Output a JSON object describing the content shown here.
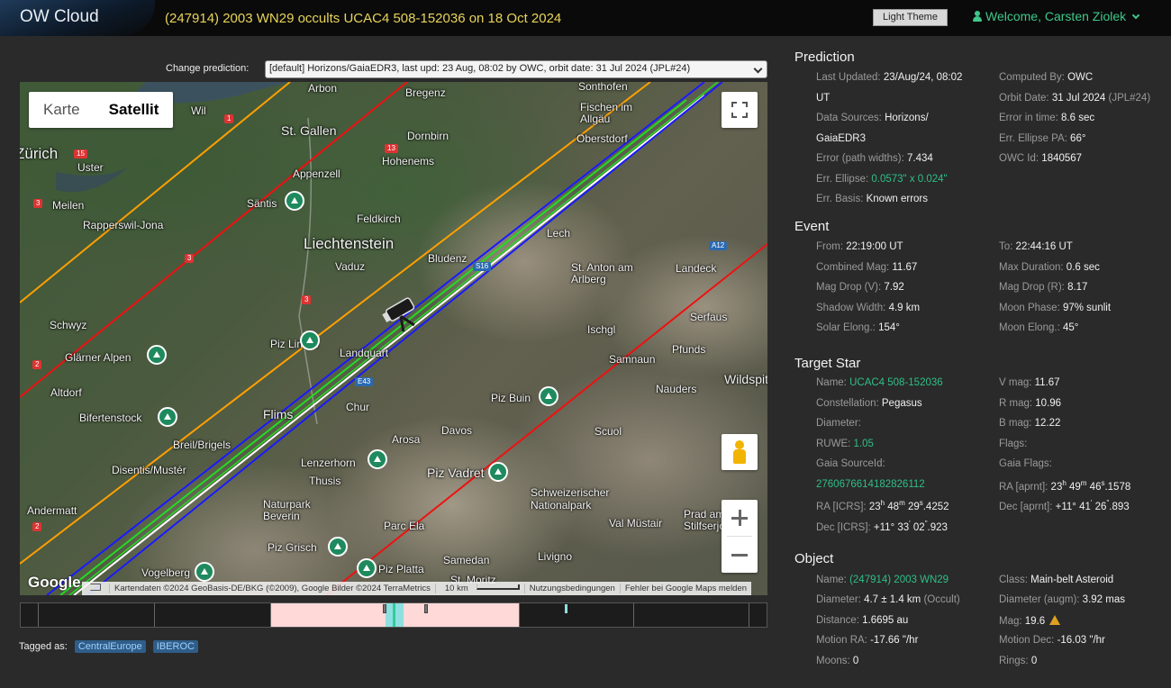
{
  "header": {
    "logo": "OW Cloud",
    "title": "(247914) 2003 WN29 occults UCAC4 508-152036 on 18 Oct 2024",
    "theme_button": "Light Theme",
    "welcome": "Welcome, Carsten Ziolek"
  },
  "prediction_select": {
    "label": "Change prediction:",
    "value": "[default] Horizons/GaiaEDR3, last upd: 23 Aug, 08:02 by OWC, orbit date: 31 Jul 2024 (JPL#24)"
  },
  "map": {
    "type_options": [
      "Karte",
      "Satellit"
    ],
    "active_type": "Satellit",
    "logo": "Google",
    "attribution": "Kartendaten ©2024 GeoBasis-DE/BKG (©2009), Google Bilder ©2024 TerraMetrics",
    "scale": "10 km",
    "terms": "Nutzungsbedingungen",
    "report": "Fehler bei Google Maps melden",
    "places": [
      "Arbon",
      "Bregenz",
      "Sonthofen",
      "Wil",
      "Fischen im Allgäu",
      "St. Gallen",
      "Dornbirn",
      "Oberstdorf",
      "Zürich",
      "Uster",
      "Appenzell",
      "Hohenems",
      "Meilen",
      "Säntis",
      "Rapperswil-Jona",
      "Feldkirch",
      "Liechtenstein",
      "Lech",
      "Vaduz",
      "Bludenz",
      "St. Anton am Arlberg",
      "Landeck",
      "Schwyz",
      "Ischgl",
      "Serfaus",
      "Glärner Alpen",
      "Piz Linard",
      "Landquart",
      "Pfunds",
      "Samnaun",
      "Altdorf",
      "Wildspitze",
      "Piz Buin",
      "Nauders",
      "Flims",
      "Chur",
      "Bifertenstock",
      "Scuol",
      "Breil/Brigels",
      "Arosa",
      "Davos",
      "Disentis/Mustér",
      "Lenzerhorn",
      "Thusis",
      "Piz Vadret",
      "Schweizerischer Nationalpark",
      "Andermatt",
      "Naturpark Beverin",
      "Parc Ela",
      "Val Müstair",
      "Prad am Stilfserjoch",
      "Piz Grisch",
      "Samedan",
      "Vogelberg",
      "Piz Platta",
      "Livigno",
      "St. Moritz"
    ],
    "road_labels": [
      "1",
      "13",
      "15",
      "3",
      "3",
      "3",
      "2",
      "2",
      "A12",
      "E43",
      "S16"
    ]
  },
  "timeline": {
    "segments": 7
  },
  "tags": {
    "label": "Tagged as:",
    "items": [
      "CentralEurope",
      "IBEROC"
    ]
  },
  "prediction": {
    "title": "Prediction",
    "last_updated_label": "Last Updated:",
    "last_updated": "23/Aug/24, 08:02",
    "last_updated_tz": "UT",
    "computed_by_label": "Computed By:",
    "computed_by": "OWC",
    "data_sources_label": "Data Sources:",
    "data_sources": "Horizons/",
    "data_sources_2": "GaiaEDR3",
    "orbit_date_label": "Orbit Date:",
    "orbit_date": "31 Jul 2024",
    "orbit_ref": "(JPL#24)",
    "error_time_label": "Error in time:",
    "error_time": "8.6 sec",
    "error_paths_label": "Error (path widths):",
    "error_paths": "7.434",
    "err_ellipse_pa_label": "Err. Ellipse PA:",
    "err_ellipse_pa": "66°",
    "err_ellipse_label": "Err. Ellipse:",
    "err_ellipse": "0.0573\" x 0.024\"",
    "owc_id_label": "OWC Id:",
    "owc_id": "1840567",
    "err_basis_label": "Err. Basis:",
    "err_basis": "Known errors"
  },
  "event": {
    "title": "Event",
    "from_label": "From:",
    "from": "22:19:00 UT",
    "to_label": "To:",
    "to": "22:44:16 UT",
    "combined_mag_label": "Combined Mag:",
    "combined_mag": "11.67",
    "max_duration_label": "Max Duration:",
    "max_duration": "0.6 sec",
    "mag_drop_v_label": "Mag Drop (V):",
    "mag_drop_v": "7.92",
    "mag_drop_r_label": "Mag Drop (R):",
    "mag_drop_r": "8.17",
    "shadow_width_label": "Shadow Width:",
    "shadow_width": "4.9 km",
    "moon_phase_label": "Moon Phase:",
    "moon_phase": "97% sunlit",
    "solar_elong_label": "Solar Elong.:",
    "solar_elong": "154°",
    "moon_elong_label": "Moon Elong.:",
    "moon_elong": "45°"
  },
  "target_star": {
    "title": "Target Star",
    "name_label": "Name:",
    "name": "UCAC4 508-152036",
    "vmag_label": "V mag:",
    "vmag": "11.67",
    "constellation_label": "Constellation:",
    "constellation": "Pegasus",
    "rmag_label": "R mag:",
    "rmag": "10.96",
    "diameter_label": "Diameter:",
    "bmag_label": "B mag:",
    "bmag": "12.22",
    "ruwe_label": "RUWE:",
    "ruwe": "1.05",
    "flags_label": "Flags:",
    "gaia_source_label": "Gaia SourceId:",
    "gaia_source": "2760676614182826112",
    "gaia_flags_label": "Gaia Flags:",
    "ra_aprnt_label": "RA [aprnt]:",
    "ra_aprnt_h": "23",
    "ra_aprnt_m": "49",
    "ra_aprnt_s": "46",
    "ra_aprnt_frac": ".1578",
    "ra_icrs_label": "RA [ICRS]:",
    "ra_icrs_h": "23",
    "ra_icrs_m": "48",
    "ra_icrs_s": "29",
    "ra_icrs_frac": ".4252",
    "dec_aprnt_label": "Dec [aprnt]:",
    "dec_aprnt_d": "+11° 41",
    "dec_aprnt_s": "26",
    "dec_aprnt_frac": ".893",
    "dec_icrs_label": "Dec [ICRS]:",
    "dec_icrs_d": "+11° 33",
    "dec_icrs_s": "02",
    "dec_icrs_frac": ".923"
  },
  "object": {
    "title": "Object",
    "name_label": "Name:",
    "name": "(247914) 2003 WN29",
    "class_label": "Class:",
    "class": "Main-belt Asteroid",
    "diameter_label": "Diameter:",
    "diameter": "4.7 ± 1.4 km",
    "diameter_note": "(Occult)",
    "diameter_augm_label": "Diameter (augm):",
    "diameter_augm": "3.92 mas",
    "distance_label": "Distance:",
    "distance": "1.6695 au",
    "mag_label": "Mag:",
    "mag": "19.6",
    "motion_ra_label": "Motion RA:",
    "motion_ra": "-17.66 \"/hr",
    "motion_dec_label": "Motion Dec:",
    "motion_dec": "-16.03 \"/hr",
    "moons_label": "Moons:",
    "moons": "0",
    "rings_label": "Rings:",
    "rings": "0"
  },
  "colors": {
    "accent": "#2fbf88",
    "title": "#e8d45a",
    "path_center": "#ffffff",
    "path_green": "#22dd22",
    "path_blue": "#1a1aff",
    "path_orange": "#ffa000",
    "path_red": "#ee1111"
  },
  "icons": [
    "user-icon",
    "chevron-down-icon",
    "fullscreen-icon",
    "pegman-icon",
    "zoom-in-icon",
    "zoom-out-icon",
    "telescope-icon",
    "warning-icon",
    "mountain-icon"
  ]
}
